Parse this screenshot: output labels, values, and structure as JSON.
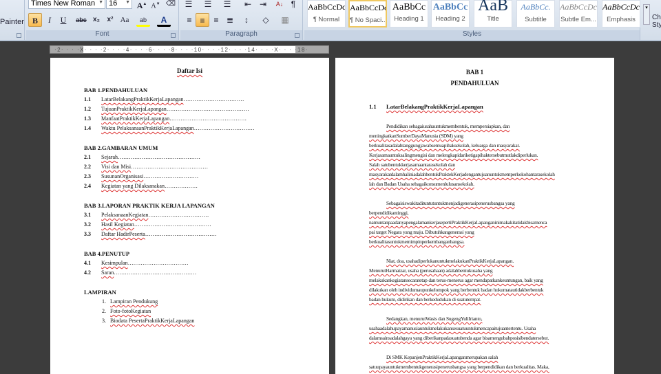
{
  "ribbon": {
    "clipboard": {
      "painter_label": "Painter"
    },
    "font": {
      "label": "Font",
      "font_name": "Times New Roman",
      "font_size": "16"
    },
    "paragraph": {
      "label": "Paragraph"
    },
    "styles": {
      "label": "Styles",
      "items": [
        {
          "preview": "AaBbCcDc",
          "name": "¶ Normal"
        },
        {
          "preview": "AaBbCcDc",
          "name": "¶ No Spaci..."
        },
        {
          "preview": "AaBbCc",
          "name": "Heading 1"
        },
        {
          "preview": "AaBbCc",
          "name": "Heading 2"
        },
        {
          "preview": "AaB",
          "name": "Title"
        },
        {
          "preview": "AaBbCc.",
          "name": "Subtitle"
        },
        {
          "preview": "AaBbCcDc",
          "name": "Subtle Em..."
        },
        {
          "preview": "AaBbCcDc",
          "name": "Emphasis"
        }
      ],
      "change_styles": "Change Styles"
    }
  },
  "ruler": {
    "ticks": "·2· · · ·X· · · ·2· · · ·4· · · ·6· · · ·8· · · ·10· · · ·12· · · ·14· · · ·X· · · ·18·"
  },
  "left_page": {
    "title": "Daftar Isi",
    "sections": [
      {
        "heading": "BAB 1.PENDAHULUAN",
        "items": [
          {
            "num": "1.1",
            "text": "LatarBelakangPraktikKerjaLapangan",
            "dots": "……………………………"
          },
          {
            "num": "1.2",
            "text": "TujuanPraktikKerjaLapangan",
            "dots": "………………………………………"
          },
          {
            "num": "1.3",
            "text": "ManfaatPraktikKerjaLapangan",
            "dots": "……………………………………"
          },
          {
            "num": "1.4",
            "text": "Waktu PelaksanaanPraktikKerjaLapangan",
            "dots": "……………………………"
          }
        ]
      },
      {
        "heading": "BAB 2.GAMBARAN UMUM",
        "items": [
          {
            "num": "2.1",
            "text": "Sejarah",
            "dots": "………………………………………"
          },
          {
            "num": "2.2",
            "text": "Visi dan Misi",
            "dots": "……………………………………"
          },
          {
            "num": "2.3",
            "text": "SusunanOrganisasi",
            "dots": "…………………………"
          },
          {
            "num": "2.4",
            "text": "Kegiatan yang Dilaksanakan",
            "dots": "………………"
          }
        ]
      },
      {
        "heading": "BAB 3.LAPORAN PRAKTIK KERJA LAPANGAN",
        "items": [
          {
            "num": "3.1",
            "text": "PelaksanaanKegiatan",
            "dots": "……………………………"
          },
          {
            "num": "3.2",
            "text": "Hasil Kegiatan",
            "dots": "……………………………………"
          },
          {
            "num": "3.3",
            "text": "Daftar HadirPeserta",
            "dots": "…………………………………"
          }
        ]
      },
      {
        "heading": "BAB 4.PENUTUP",
        "items": [
          {
            "num": "4.1",
            "text": "Kesimpulan",
            "dots": "……………………………"
          },
          {
            "num": "4.2",
            "text": "Saran",
            "dots": "………………………………………"
          }
        ]
      },
      {
        "heading": "LAMPIRAN",
        "items": [
          {
            "num": "1.",
            "text": "Lampiran Pendukung",
            "dots": ""
          },
          {
            "num": "2.",
            "text": "Foto-fotoKegiatan",
            "dots": ""
          },
          {
            "num": "3.",
            "text": "Biodata PesertaPraktikKerjaLapangan",
            "dots": ""
          }
        ]
      }
    ]
  },
  "right_page": {
    "chapter": "BAB 1",
    "chapter_title": "PENDAHULUAN",
    "section_num": "1.1",
    "section_title": "LatarBelakangPraktikKerjaLapangan",
    "paragraphs": [
      [
        "Pendidikan sebagaiusahauntukmembentuk, mempersiapkan, dan",
        "meningkatkanSumberDayaManusia (SDM) yang",
        "berkualitasadalahtanggungjawabsemuapihaksekolah, keluarga dan masyarakat.",
        "Kerjasamauntuksalingmengisi dan melengkapidariketigapihaktersebutmutlakdiperlukan.",
        "Salah satubentukkerjasamaantarasekolah dan",
        "masyarakatdalamhaliniadalahbentukPraktekKerjadengantujuanuntukmemperkokohantarasekolah",
        "lah dan Badan Usaha sebagaikonsumenlulusansekolah."
      ],
      [
        "Sebagaisiswakitadituntutuntukmenjadigenerasipenerusbangsa yang",
        "berpendidikantinggi,",
        "namuntanpaadanyapengalamankerjasepertiPraktikKerjaLapanganinimakakitatidakbisamenca",
        "pai target Negara yang maju. Dibutuhkangenerasi yang",
        "berkualitasuntukmemimpinperkembanganbangsa."
      ],
      [
        "Niat, doa, usahadiperlukanuntukmelakukanPraktikKerjaLapangan.",
        "MenurutHarmaizar, usaha (perusahaan) adalahbentukusaha yang",
        "melakukankegiatansecaratetap dan terus-menerus agar mendapatkankeuntungan, baik yang",
        "dilakukan oleh individumaupunkelompok yang berbentuk badan hukumatautidakberbentuk",
        "badan hukum, didirikan dan berkedudukan di suatutempat."
      ],
      [
        "Sedangkan, menurutWasis dan SugengYuliIrianto,",
        "usahaadalahupayamanusiauntukmelakukansesuatuuntukmencapaitujuantertentu. Usaha",
        "dalamsainsadalahgaya yang diberikanpadasuatubenda agar bisamengubahposisibendatersebut."
      ],
      [
        "Di SMK KepanjenPraktikKerjaLapanganmerupakan salah",
        "satuupayauntukmembentukgenerasipenerusbangsa yang berpendidikan dan berkualitas. Maka,"
      ]
    ]
  },
  "colors": {
    "ribbon": "#dfe6ef",
    "workspace": "#3c3c3c",
    "page": "#ffffff",
    "spell_squiggle": "#dd3333",
    "active_button": "#f8b94d"
  }
}
